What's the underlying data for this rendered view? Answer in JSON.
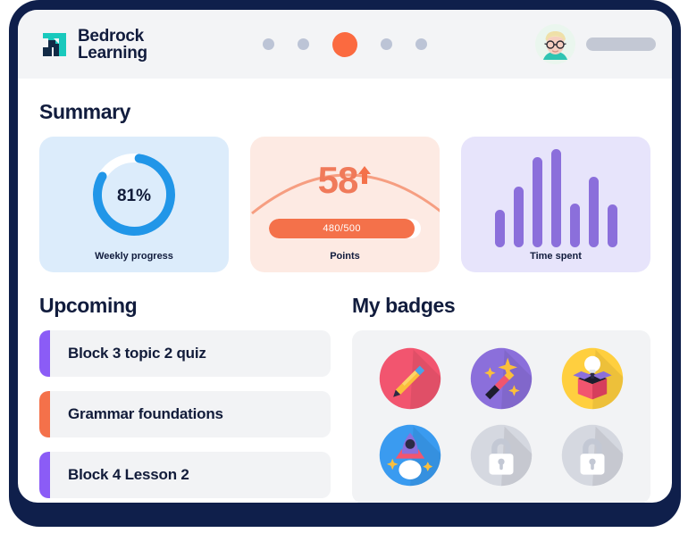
{
  "brand": {
    "line1": "Bedrock",
    "line2": "Learning",
    "mark_icon": "bedrock-logo-icon",
    "teal": "#19c9bd",
    "navy": "#122a46"
  },
  "header": {
    "nav_dots": [
      {
        "name": "nav-dot-1",
        "active": false
      },
      {
        "name": "nav-dot-2",
        "active": false
      },
      {
        "name": "nav-dot-3",
        "active": true
      },
      {
        "name": "nav-dot-4",
        "active": false
      },
      {
        "name": "nav-dot-5",
        "active": false
      }
    ],
    "active_dot_color": "#fb6a40",
    "inactive_dot_color": "#bcc4d6",
    "avatar_icon": "user-avatar-icon",
    "name_placeholder_color": "#c3c8d4"
  },
  "summary": {
    "title": "Summary",
    "cards": {
      "progress": {
        "value_label": "81%",
        "percent": 81,
        "label": "Weekly progress",
        "bg": "#dcecfb",
        "ring": "#2196e8",
        "track": "#ffffff"
      },
      "points": {
        "value_label": "58",
        "trend_icon": "arrow-up-icon",
        "bar_label": "480/500",
        "current": 480,
        "total": 500,
        "label": "Points",
        "bg": "#fdeae3",
        "accent": "#f4714a"
      },
      "time": {
        "label": "Time spent",
        "bg": "#e7e4fb",
        "bar_color": "#8b6fdb",
        "bars": [
          38,
          62,
          92,
          100,
          45,
          72,
          44
        ]
      }
    }
  },
  "upcoming": {
    "title": "Upcoming",
    "items": [
      {
        "label": "Block 3 topic 2 quiz",
        "accent": "#8b5cf6"
      },
      {
        "label": "Grammar foundations",
        "accent": "#f4714a"
      },
      {
        "label": "Block 4 Lesson 2",
        "accent": "#8b5cf6"
      }
    ]
  },
  "badges": {
    "title": "My badges",
    "items": [
      {
        "name": "badge-pencil",
        "icon": "pencil-icon",
        "bg": "#f2556f",
        "locked": false
      },
      {
        "name": "badge-magic-wand",
        "icon": "magic-wand-icon",
        "bg": "#8b6fdb",
        "locked": false
      },
      {
        "name": "badge-idea-box",
        "icon": "lightbulb-box-icon",
        "bg": "#ffcf3f",
        "locked": false
      },
      {
        "name": "badge-rocket",
        "icon": "rocket-icon",
        "bg": "#3a9bf0",
        "locked": false
      },
      {
        "name": "badge-locked-1",
        "icon": "lock-icon",
        "bg": "#d5d8e0",
        "locked": true
      },
      {
        "name": "badge-locked-2",
        "icon": "lock-icon",
        "bg": "#d5d8e0",
        "locked": true
      }
    ]
  }
}
